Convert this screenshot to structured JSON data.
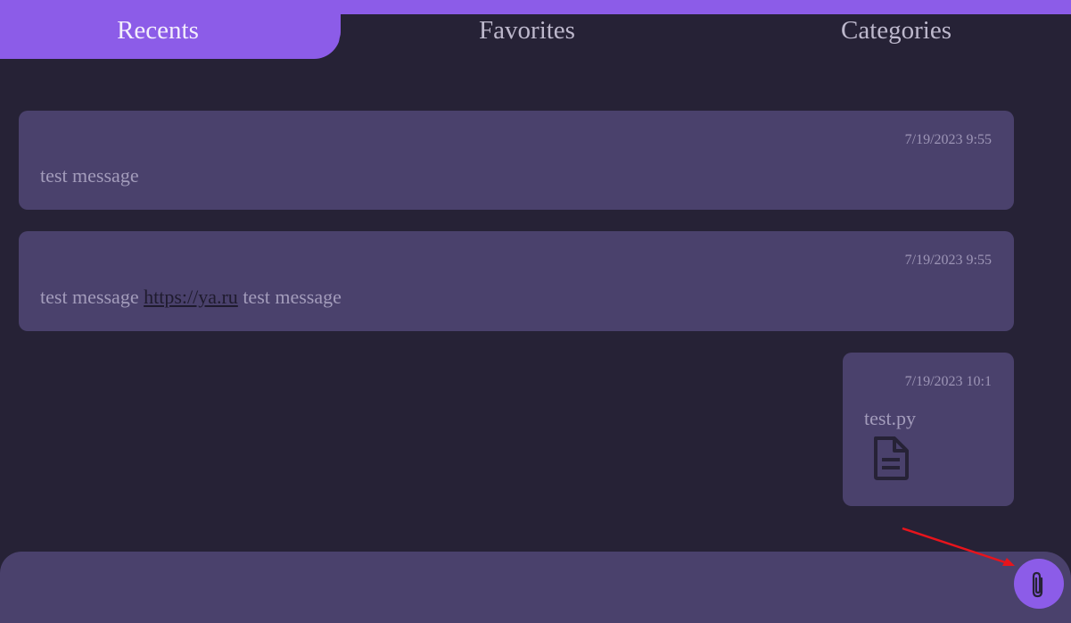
{
  "tabs": [
    {
      "label": "Recents",
      "active": true
    },
    {
      "label": "Favorites",
      "active": false
    },
    {
      "label": "Categories",
      "active": false
    }
  ],
  "messages": [
    {
      "timestamp": "7/19/2023 9:55",
      "text": "test message"
    },
    {
      "timestamp": "7/19/2023 9:55",
      "text_before": "test message ",
      "link": "https://ya.ru",
      "text_after": " test message"
    },
    {
      "timestamp": "7/19/2023 10:1",
      "file_name": "test.py",
      "icon": "document-icon"
    }
  ],
  "input": {
    "placeholder": "",
    "value": ""
  },
  "attach": {
    "icon": "paperclip-icon"
  },
  "colors": {
    "background": "#262236",
    "accent": "#8c5ce8",
    "card": "#4a416c",
    "annotation": "#e8141c"
  }
}
